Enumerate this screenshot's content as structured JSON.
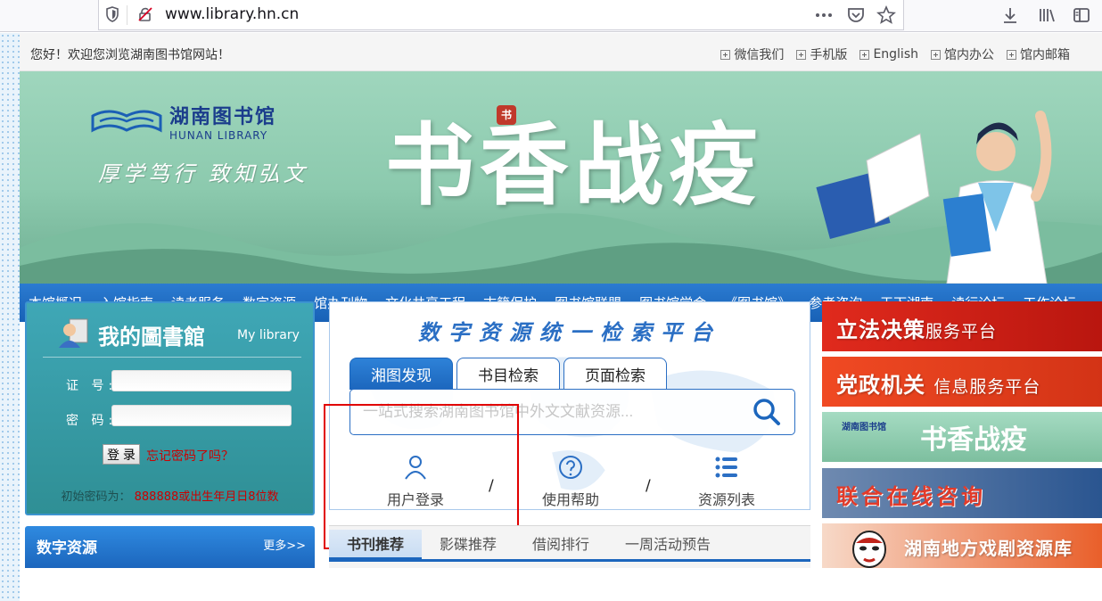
{
  "browser": {
    "url": "www.library.hn.cn"
  },
  "topbar": {
    "welcome": "您好！欢迎您浏览湖南图书馆网站！",
    "links": [
      "微信我们",
      "手机版",
      "English",
      "馆内办公",
      "馆内邮箱"
    ]
  },
  "banner": {
    "logo_cn": "湖南图书馆",
    "logo_en": "HUNAN LIBRARY",
    "motto": "厚学笃行 致知弘文",
    "title": "书香战疫",
    "seal": "书"
  },
  "nav": {
    "items": [
      "本馆概况",
      "入馆指南",
      "读者服务",
      "数字资源",
      "馆办刊物",
      "文化共享工程",
      "古籍保护",
      "图书馆联盟",
      "图书馆学会",
      "《图书馆》",
      "参考咨询",
      "天下湖南",
      "读行论坛",
      "工作论坛"
    ]
  },
  "login": {
    "title": "我的圖書館",
    "title_en": "My library",
    "id_label": "证 号:",
    "pwd_label": "密 码:",
    "login_button": "登 录",
    "forgot": "忘记密码了吗？",
    "hint_label": "初始密码为：",
    "hint_value": "888888或出生年月日8位数"
  },
  "digital": {
    "title": "数字资源",
    "more": "更多>>"
  },
  "search": {
    "title": "数字资源统一检索平台",
    "tabs": [
      "湘图发现",
      "书目检索",
      "页面检索"
    ],
    "placeholder": "一站式搜索湖南图书馆中外文文献资源...",
    "quick": [
      "用户登录",
      "使用帮助",
      "资源列表"
    ],
    "slash": "/"
  },
  "recommend": {
    "tabs": [
      "书刊推荐",
      "影碟推荐",
      "借阅排行",
      "一周活动预告"
    ]
  },
  "right_banners": [
    {
      "main": "立法决策",
      "sub": "服务平台",
      "color": "#d6261c"
    },
    {
      "main": "党政机关",
      "sub": "信息服务平台",
      "color": "#e8401c"
    },
    {
      "main": "",
      "sub": "",
      "color": "#8ccaae"
    },
    {
      "main": "联合在线咨询",
      "sub": "",
      "color": "#2a66b5"
    },
    {
      "main": "湖南地方戏剧资源库",
      "sub": "",
      "color": "#e04a1f"
    }
  ],
  "right_banner_3": {
    "logo": "湖南图书馆",
    "title": "书香战疫"
  },
  "colors": {
    "nav_blue": "#1861b6",
    "accent_red": "#e10000",
    "login_teal": "#2f8f95"
  }
}
